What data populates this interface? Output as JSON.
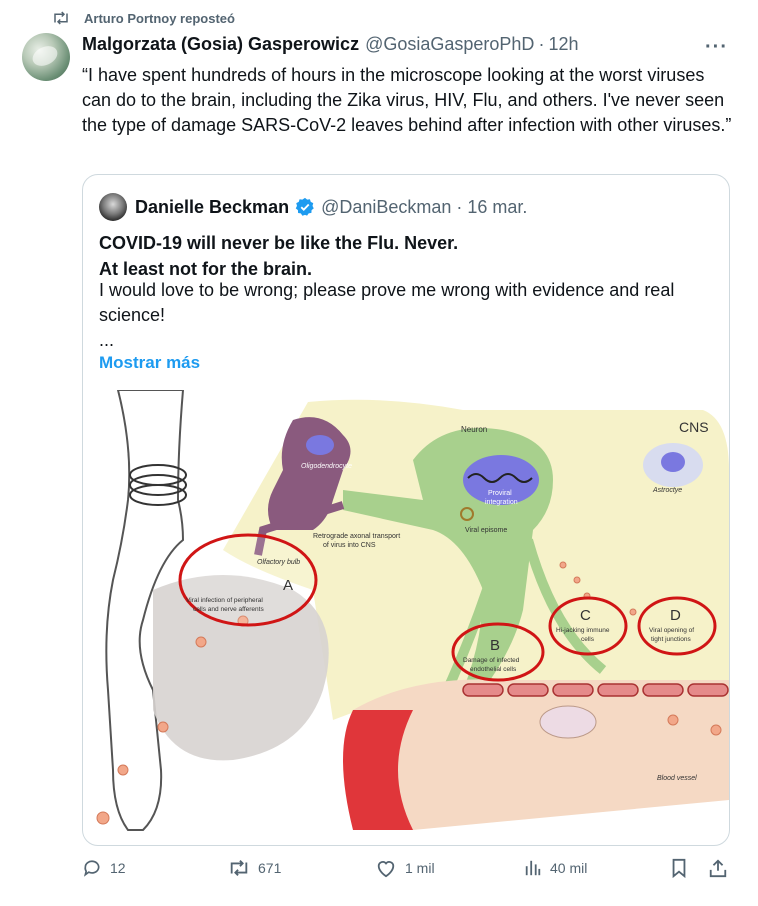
{
  "repost": {
    "text": "Arturo Portnoy reposteó"
  },
  "author": {
    "name": "Malgorzata (Gosia) Gasperowicz",
    "handle": "@GosiaGasperoPhD",
    "time": "12h"
  },
  "tweet_text": "“I have spent hundreds of hours in the microscope looking at the worst viruses can do to the brain, including the Zika virus, HIV, Flu, and others. I've never seen the type of damage SARS-CoV-2 leaves behind after infection with other viruses.”",
  "quote": {
    "name": "Danielle Beckman",
    "handle": "@DaniBeckman",
    "date": "16 mar.",
    "bold_line1": "COVID-19 will never be like the Flu. Never.",
    "bold_line2": "At least not for the brain.",
    "text": "I would love to be wrong; please prove me wrong with evidence and real science!",
    "ellipsis": "...",
    "show_more": "Mostrar más"
  },
  "diagram": {
    "cns": "CNS",
    "neuron": "Neuron",
    "oligodendrocyte": "Oligodendrocyte",
    "proviral1": "Proviral",
    "proviral2": "integration",
    "astrocyte": "Astroctye",
    "viral_episome": "Viral episome",
    "retrograde1": "Retrograde axonal transport",
    "retrograde2": "of virus into CNS",
    "olfactory_bulb": "Olfactory bulb",
    "A": "A",
    "A_text1": "Viral infection of peripheral",
    "A_text2": "cells and nerve afferents",
    "B": "B",
    "B_text1": "Damage of infected",
    "B_text2": "endothelial cells",
    "C": "C",
    "C_text1": "Hi-jacking immune",
    "C_text2": "cells",
    "D": "D",
    "D_text1": "Viral opening of",
    "D_text2": "tight junctions",
    "blood_vessel": "Blood vessel"
  },
  "actions": {
    "replies": "12",
    "reposts": "671",
    "likes": "1 mil",
    "views": "40 mil"
  },
  "colors": {
    "link": "#1d9bf0",
    "muted": "#536471",
    "verified": "#1d9bf0",
    "repost_icon": "#536471"
  },
  "icons": [
    "repost-icon",
    "more-icon",
    "verified-icon",
    "reply-icon",
    "heart-icon",
    "views-icon",
    "bookmark-icon",
    "share-icon"
  ]
}
